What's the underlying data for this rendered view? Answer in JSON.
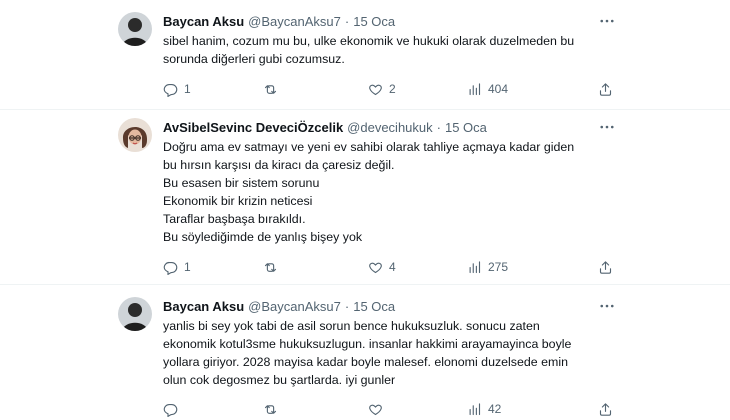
{
  "tweets": [
    {
      "name": "Baycan Aksu",
      "handle": "@BaycanAksu7",
      "separator": "·",
      "date": "15 Oca",
      "lines": [
        "sibel hanim, cozum mu bu, ulke ekonomik ve hukuki olarak duzelmeden bu",
        "sorunda diğerleri gubi cozumsuz."
      ],
      "replies": "1",
      "retweets": "",
      "likes": "2",
      "views": "404",
      "avatar_icon": "user-avatar-dark"
    },
    {
      "name": "AvSibelSevinc DeveciÖzcelik",
      "handle": "@devecihukuk",
      "separator": "·",
      "date": "15 Oca",
      "lines": [
        "Doğru ama ev satmayı ve yeni ev sahibi olarak tahliye açmaya kadar giden",
        "bu hırsın karşısı da kiracı da çaresiz değil.",
        "Bu esasen bir sistem sorunu",
        "Ekonomik bir krizin neticesi",
        "Taraflar başbaşa bırakıldı.",
        "Bu söylediğimde de yanlış bişey yok"
      ],
      "replies": "1",
      "retweets": "",
      "likes": "4",
      "views": "275",
      "avatar_icon": "user-avatar-photo"
    },
    {
      "name": "Baycan Aksu",
      "handle": "@BaycanAksu7",
      "separator": "·",
      "date": "15 Oca",
      "lines": [
        "yanlis bi sey yok tabi de asil sorun bence hukuksuzluk. sonucu zaten",
        "ekonomik kotul3sme hukuksuzlugun. insanlar hakkimi arayamayinca boyle",
        "yollara giriyor. 2028 mayisa kadar boyle malesef. elonomi duzelsede emin",
        "olun cok degosmez bu şartlarda. iyi gunler"
      ],
      "replies": "",
      "retweets": "",
      "likes": "",
      "views": "42",
      "avatar_icon": "user-avatar-dark"
    }
  ],
  "icons": {
    "more": "more-horizontal-icon",
    "reply": "reply-icon",
    "retweet": "retweet-icon",
    "like": "heart-icon",
    "views": "views-chart-icon",
    "share": "share-icon"
  },
  "colors": {
    "text": "#0f1419",
    "secondary": "#536471",
    "divider": "#eff3f4"
  }
}
